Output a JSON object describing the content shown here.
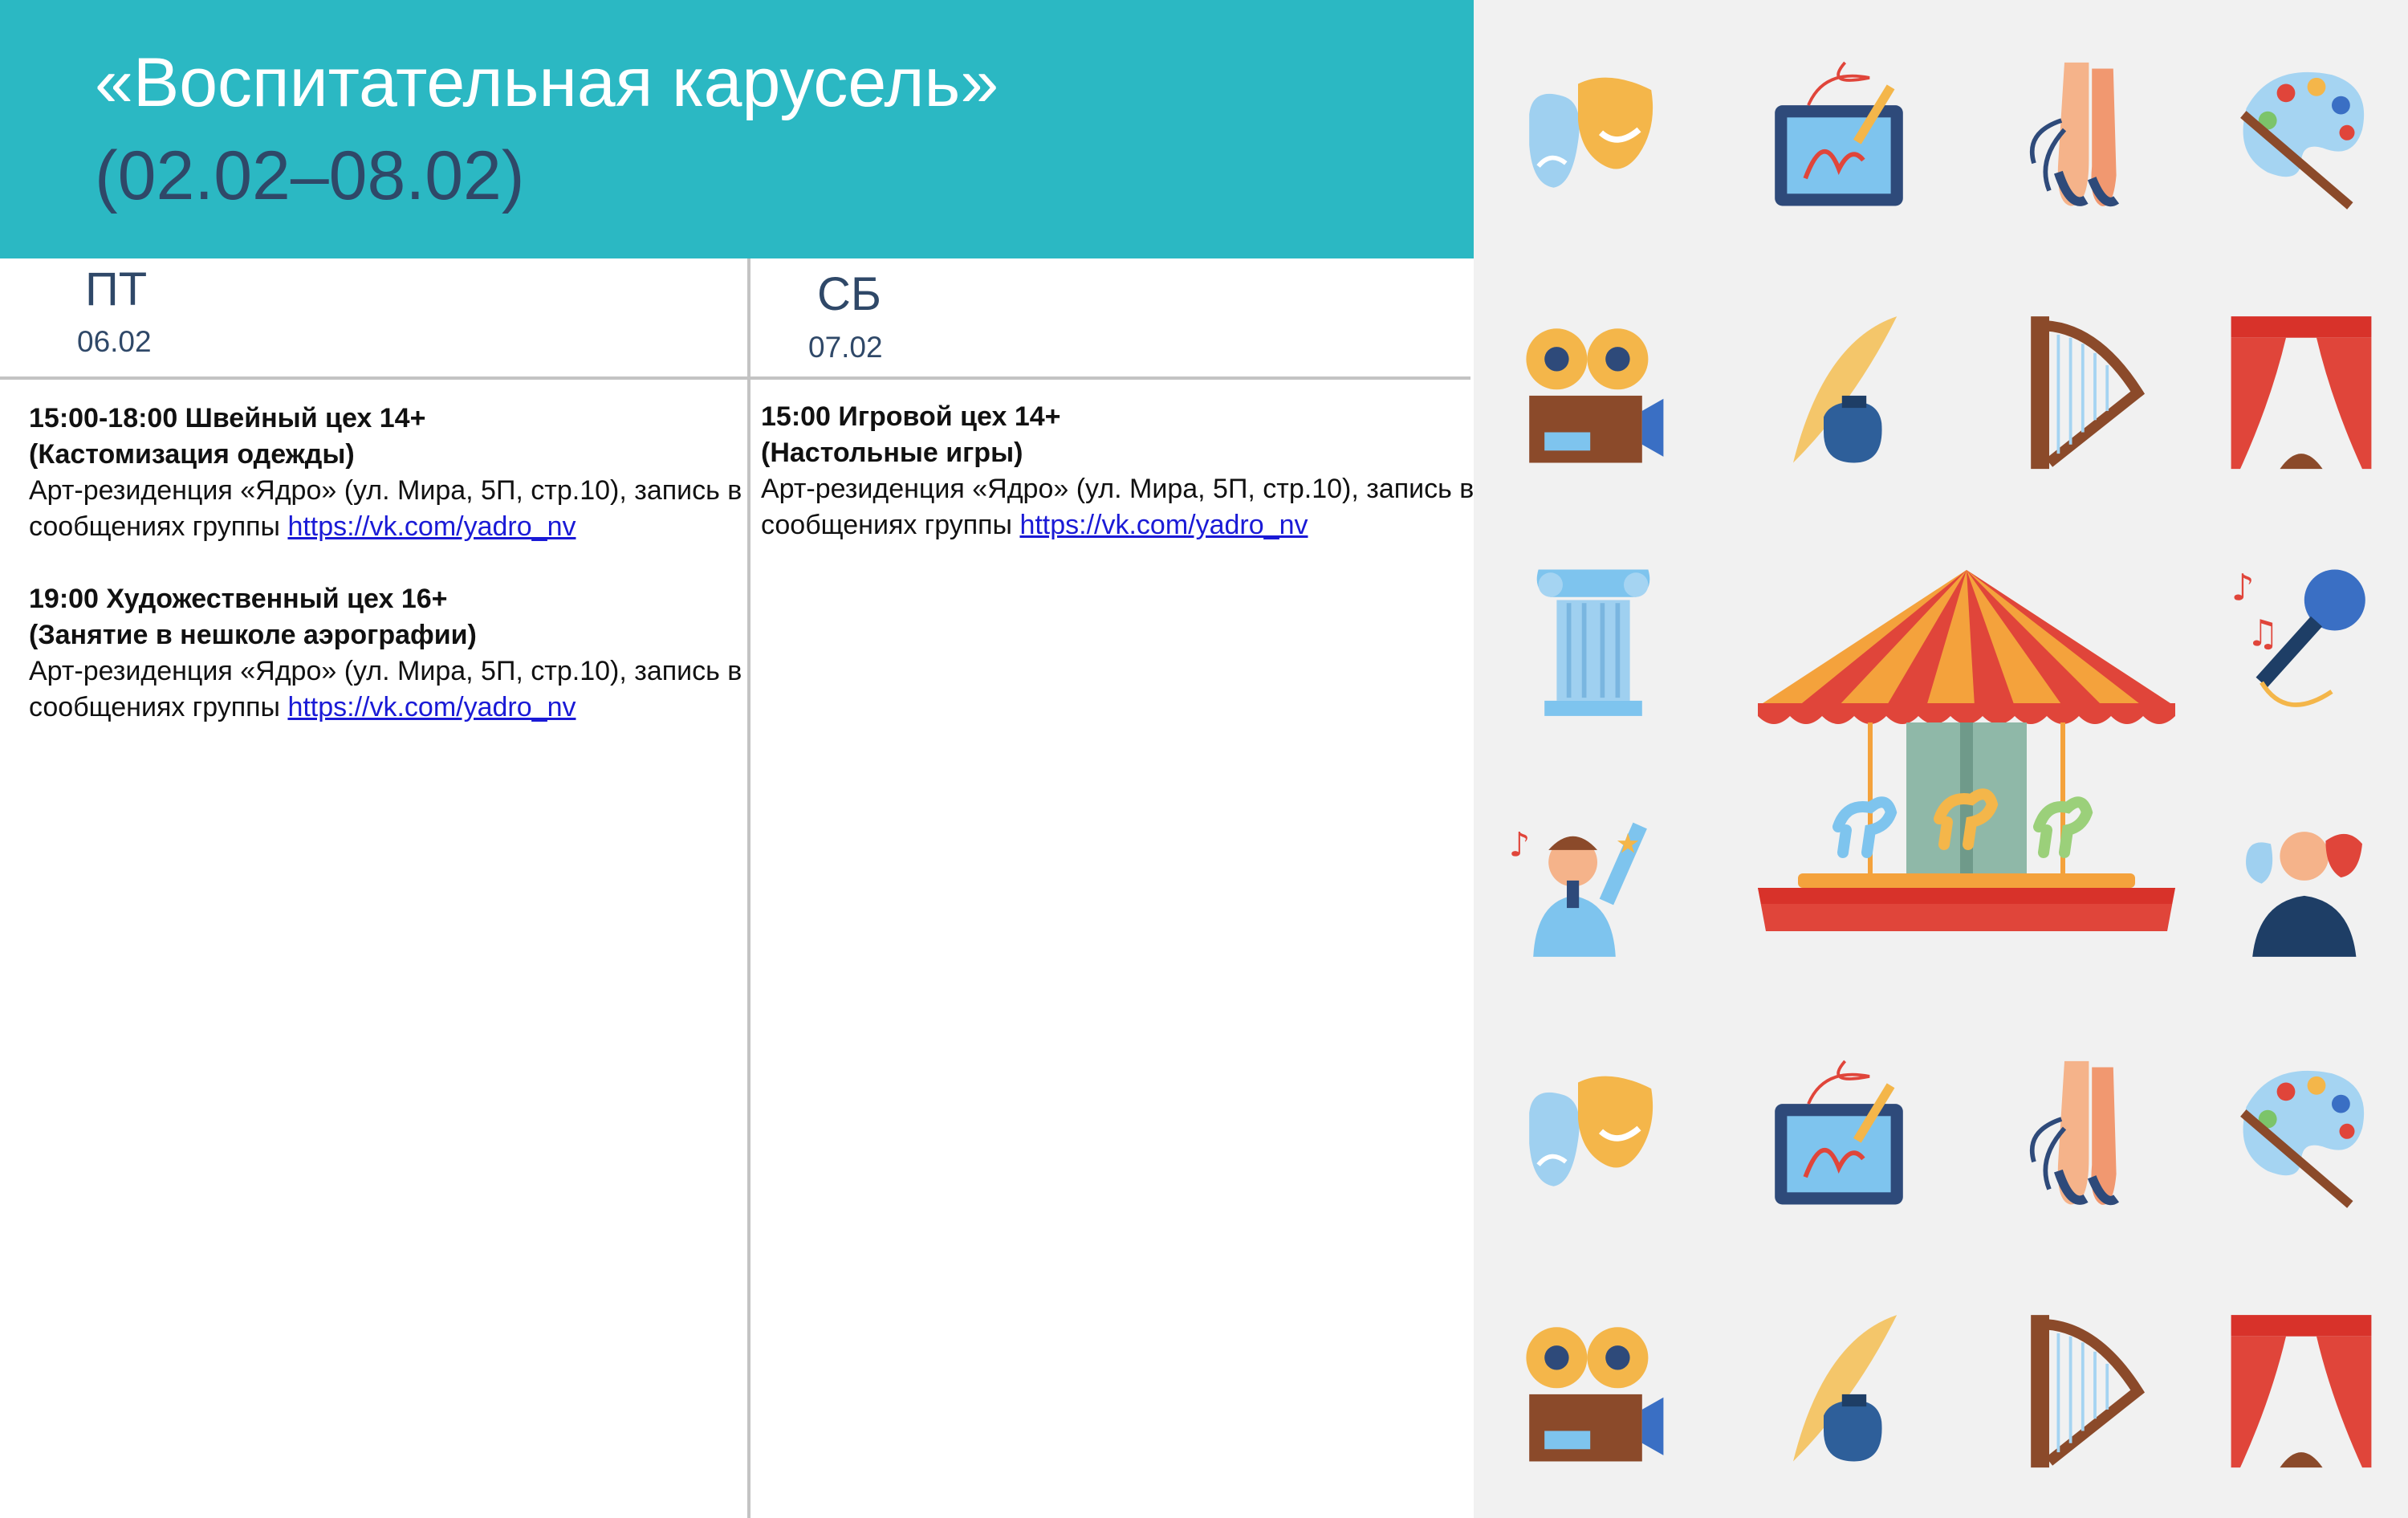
{
  "header": {
    "title": "«Воспитательная карусель»",
    "period": "(02.02–08.02)"
  },
  "columns": [
    {
      "day": "ПТ",
      "date": "06.02",
      "events": [
        {
          "time_title": "15:00-18:00 Швейный цех 14+",
          "subtitle": "(Кастомизация одежды)",
          "location": "Арт-резиденция «Ядро» (ул. Мира, 5П, стр.10), запись в сообщениях группы ",
          "link": "https://vk.com/yadro_nv"
        },
        {
          "time_title": "19:00 Художественный цех 16+",
          "subtitle": "(Занятие в нешколе аэрографии)",
          "location": "Арт-резиденция «Ядро» (ул. Мира, 5П, стр.10), запись в сообщениях группы ",
          "link": "https://vk.com/yadro_nv"
        }
      ]
    },
    {
      "day": "СБ",
      "date": "07.02",
      "events": [
        {
          "time_title": "15:00 Игровой цех 14+",
          "subtitle": "(Настольные игры)",
          "location": "Арт-резиденция «Ядро» (ул. Мира, 5П, стр.10), запись в сообщениях группы ",
          "link": "https://vk.com/yadro_nv"
        }
      ]
    }
  ],
  "decor": {
    "icons": [
      "theater-masks-icon",
      "drawing-tablet-icon",
      "ballet-shoes-icon",
      "paint-palette-icon",
      "film-projector-icon",
      "quill-inkwell-icon",
      "harp-icon",
      "stage-curtain-icon",
      "column-icon",
      "microphone-icon",
      "singer-icon",
      "actor-icon",
      "carousel-icon"
    ],
    "colors": {
      "header": "#2bb8c3",
      "title_dark": "#2f4868",
      "panel": "#f1f1f1",
      "link": "#1a1ad6"
    }
  }
}
